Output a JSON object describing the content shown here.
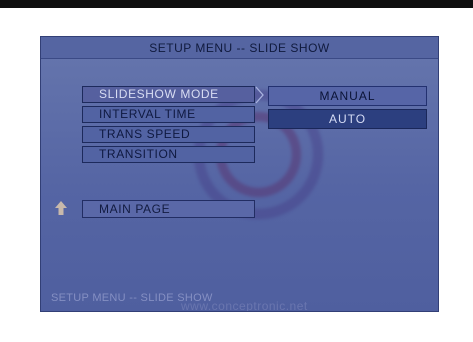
{
  "header": {
    "title": "SETUP MENU -- SLIDE SHOW"
  },
  "menu": {
    "items": [
      {
        "label": "SLIDESHOW MODE",
        "selected": true
      },
      {
        "label": "INTERVAL TIME",
        "selected": false
      },
      {
        "label": "TRANS SPEED",
        "selected": false
      },
      {
        "label": "TRANSITION",
        "selected": false
      }
    ]
  },
  "navigation": {
    "main_page_label": "MAIN PAGE",
    "up_icon": "up-arrow-icon"
  },
  "submenu": {
    "options": [
      {
        "label": "MANUAL",
        "highlighted": false
      },
      {
        "label": "AUTO",
        "highlighted": true
      }
    ]
  },
  "footer": {
    "label": "SETUP MENU -- SLIDE SHOW"
  },
  "watermark": {
    "text": "www.conceptronic.net"
  },
  "colors": {
    "screen_bg": "#5565a4",
    "title_bar": "#5565a2",
    "selected_text": "#d8ddf3",
    "option_highlight": "#2c3f7f",
    "arrow": "#c8b9ab"
  }
}
